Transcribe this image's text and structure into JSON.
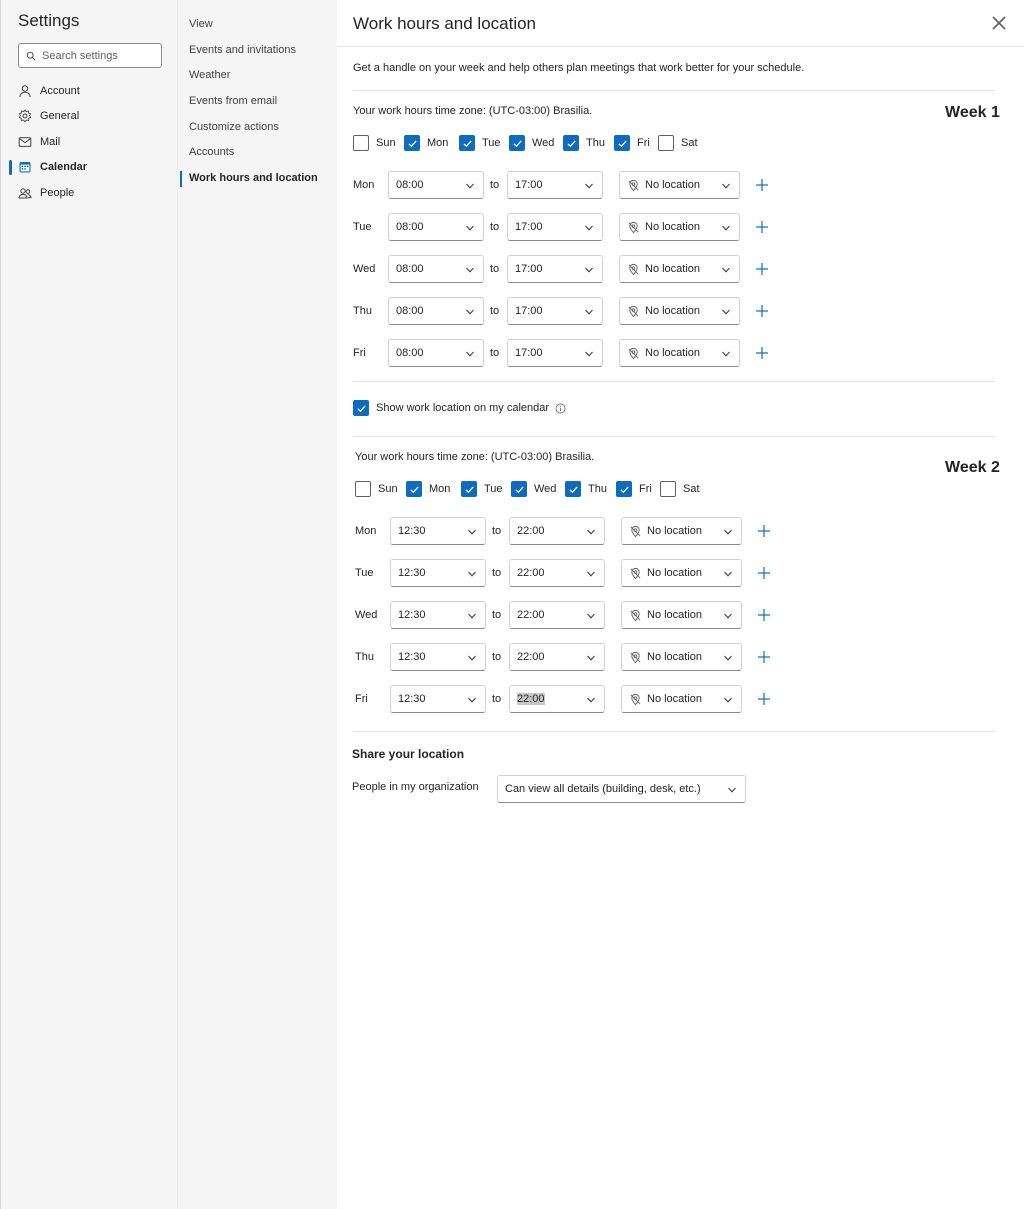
{
  "app": {
    "title": "Settings",
    "search_placeholder": "Search settings"
  },
  "categories": [
    {
      "label": "Account",
      "icon": "person-icon"
    },
    {
      "label": "General",
      "icon": "gear-icon"
    },
    {
      "label": "Mail",
      "icon": "mail-icon"
    },
    {
      "label": "Calendar",
      "icon": "calendar-icon",
      "active": true
    },
    {
      "label": "People",
      "icon": "people-icon"
    }
  ],
  "subnav": [
    {
      "label": "View"
    },
    {
      "label": "Events and invitations"
    },
    {
      "label": "Weather"
    },
    {
      "label": "Events from email"
    },
    {
      "label": "Customize actions"
    },
    {
      "label": "Accounts"
    },
    {
      "label": "Work hours and location",
      "active": true
    }
  ],
  "page": {
    "title": "Work hours and location",
    "description": "Get a handle on your week and help others plan meetings that work better for your schedule.",
    "show_location_label": "Show work location on my calendar",
    "show_location_checked": true
  },
  "week1": {
    "title": "Week 1",
    "timezone": "Your work hours time zone: (UTC-03:00) Brasilia.",
    "days": [
      {
        "label": "Sun",
        "checked": false
      },
      {
        "label": "Mon",
        "checked": true
      },
      {
        "label": "Tue",
        "checked": true
      },
      {
        "label": "Wed",
        "checked": true
      },
      {
        "label": "Thu",
        "checked": true
      },
      {
        "label": "Fri",
        "checked": true
      },
      {
        "label": "Sat",
        "checked": false
      }
    ],
    "rows": [
      {
        "day": "Mon",
        "start": "08:00",
        "to": "to",
        "end": "17:00",
        "location": "No location"
      },
      {
        "day": "Tue",
        "start": "08:00",
        "to": "to",
        "end": "17:00",
        "location": "No location"
      },
      {
        "day": "Wed",
        "start": "08:00",
        "to": "to",
        "end": "17:00",
        "location": "No location"
      },
      {
        "day": "Thu",
        "start": "08:00",
        "to": "to",
        "end": "17:00",
        "location": "No location"
      },
      {
        "day": "Fri",
        "start": "08:00",
        "to": "to",
        "end": "17:00",
        "location": "No location"
      }
    ]
  },
  "week2": {
    "title": "Week 2",
    "timezone": "Your work hours time zone: (UTC-03:00) Brasilia.",
    "days": [
      {
        "label": "Sun",
        "checked": false
      },
      {
        "label": "Mon",
        "checked": true
      },
      {
        "label": "Tue",
        "checked": true
      },
      {
        "label": "Wed",
        "checked": true
      },
      {
        "label": "Thu",
        "checked": true
      },
      {
        "label": "Fri",
        "checked": true
      },
      {
        "label": "Sat",
        "checked": false
      }
    ],
    "rows": [
      {
        "day": "Mon",
        "start": "12:30",
        "to": "to",
        "end": "22:00",
        "location": "No location"
      },
      {
        "day": "Tue",
        "start": "12:30",
        "to": "to",
        "end": "22:00",
        "location": "No location"
      },
      {
        "day": "Wed",
        "start": "12:30",
        "to": "to",
        "end": "22:00",
        "location": "No location"
      },
      {
        "day": "Thu",
        "start": "12:30",
        "to": "to",
        "end": "22:00",
        "location": "No location"
      },
      {
        "day": "Fri",
        "start": "12:30",
        "to": "to",
        "end": "22:00",
        "location": "No location",
        "end_highlighted": true
      }
    ]
  },
  "share": {
    "title": "Share your location",
    "label": "People in my organization",
    "value": "Can view all details (building, desk, etc.)"
  },
  "colors": {
    "accent": "#0f6cbd",
    "sidebar_bg": "#f5f5f5"
  }
}
